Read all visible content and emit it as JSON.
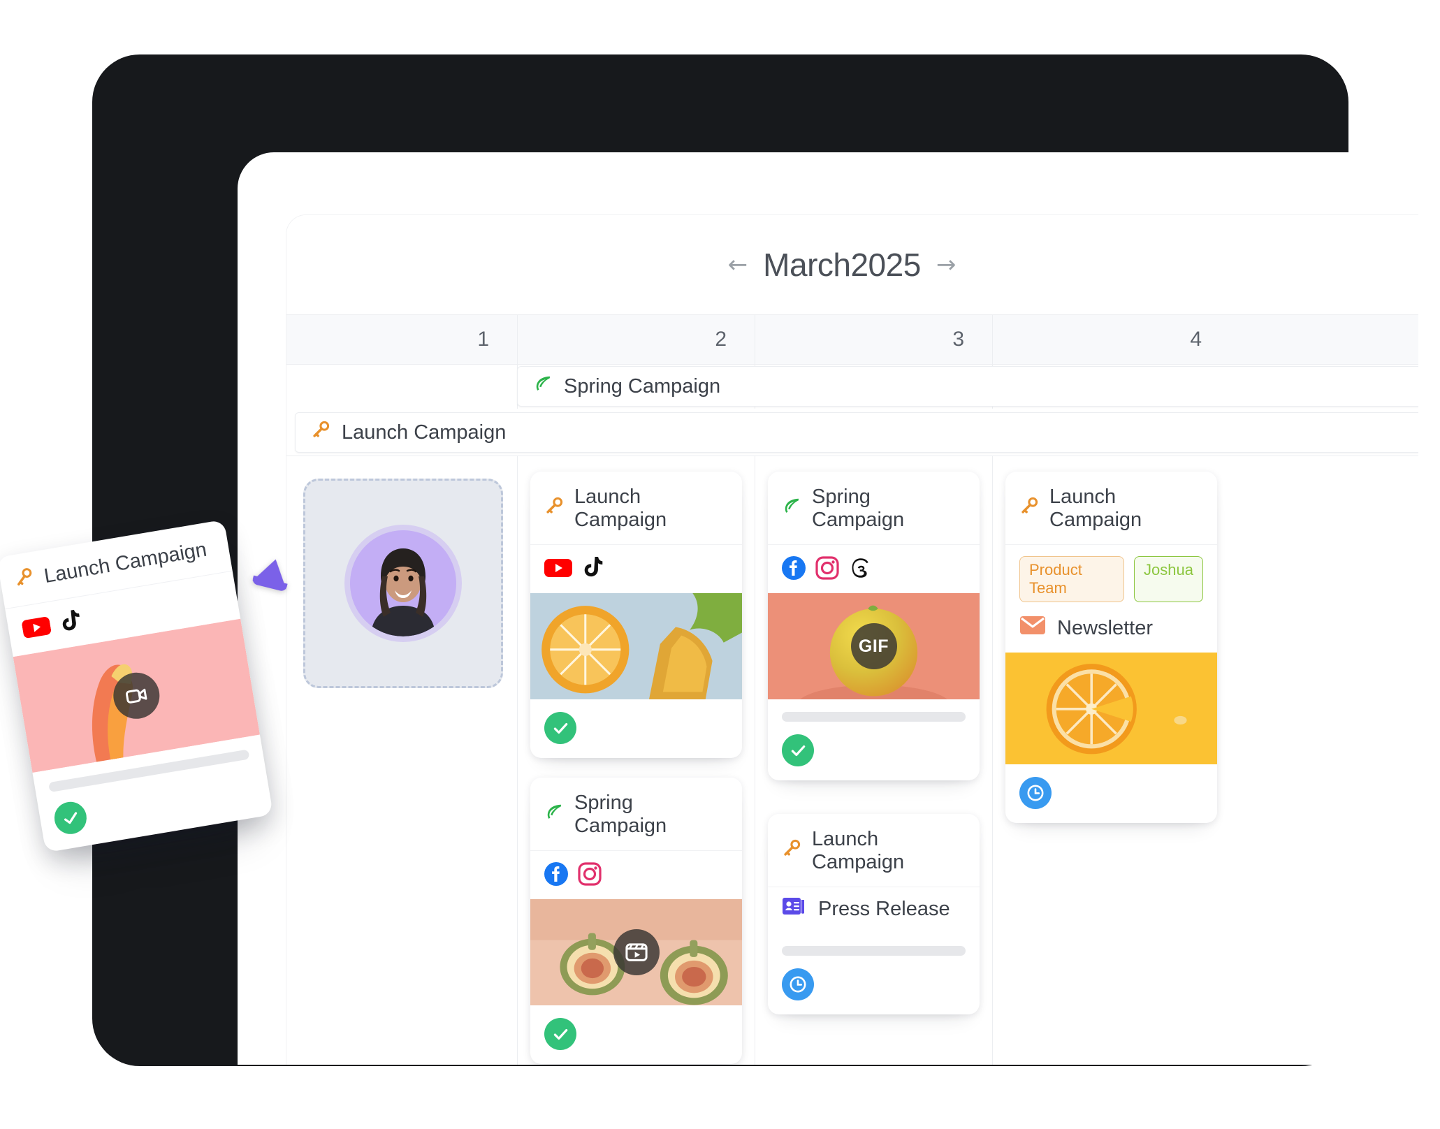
{
  "header": {
    "prev_label": "←",
    "next_label": "→",
    "month_label": "March2025",
    "prev_name": "previous-month",
    "next_name": "next-month"
  },
  "day_columns": [
    {
      "label": "1"
    },
    {
      "label": "2"
    },
    {
      "label": "3"
    },
    {
      "label": "4"
    }
  ],
  "span_bars": [
    {
      "label": "Spring Campaign",
      "icon": "leaf-icon",
      "color": "#2cb34a"
    },
    {
      "label": "Launch Campaign",
      "icon": "key-icon",
      "color": "#e8912c"
    }
  ],
  "drop_zone": {
    "name": "drop-zone",
    "avatar_name": "avatar"
  },
  "drag_card": {
    "title": "Launch Campaign",
    "campaign_icon": "key-icon",
    "channels": [
      "youtube-icon",
      "tiktok-icon"
    ],
    "media_badge": "video-camera-icon",
    "media_style": "m-pink",
    "status": "done"
  },
  "columns": [
    {
      "index": 1,
      "cards": []
    },
    {
      "index": 2,
      "cards": [
        {
          "title": "Launch Campaign",
          "campaign_icon": "key-icon",
          "channels": [
            "youtube-icon",
            "tiktok-icon"
          ],
          "media_style": "m-citrus",
          "media_badge": "",
          "skeleton": false,
          "status": "done",
          "stacked": false
        },
        {
          "title": "Spring Campaign",
          "campaign_icon": "leaf-icon",
          "channels": [
            "facebook-icon",
            "instagram-icon"
          ],
          "media_style": "m-figs",
          "media_badge": "reels-icon",
          "skeleton": false,
          "status": "done",
          "stacked": true
        }
      ]
    },
    {
      "index": 3,
      "cards": [
        {
          "title": "Spring Campaign",
          "campaign_icon": "leaf-icon",
          "channels": [
            "facebook-icon",
            "instagram-icon",
            "threads-icon"
          ],
          "media_style": "m-grapefruit",
          "media_badge": "GIF",
          "skeleton": true,
          "status": "done",
          "stacked": false
        },
        {
          "title": "Launch Campaign",
          "campaign_icon": "key-icon",
          "subtitle": "Press Release",
          "subtitle_icon": "press-release-icon",
          "skeleton": true,
          "status": "scheduled",
          "stacked": false
        }
      ]
    },
    {
      "index": 4,
      "cards": [
        {
          "title": "Launch Campaign",
          "campaign_icon": "key-icon",
          "tags": [
            {
              "label": "Product Team",
              "style": "tag-orange"
            },
            {
              "label": "Joshua",
              "style": "tag-green"
            }
          ],
          "subtitle": "Newsletter",
          "subtitle_icon": "newsletter-icon",
          "media_style": "m-orange-yellow",
          "media_badge": "",
          "skeleton": false,
          "status": "scheduled",
          "stacked": false
        }
      ]
    }
  ],
  "colors": {
    "accent_purple": "#7b61e8",
    "status_done": "#32c27a",
    "status_scheduled": "#389af0",
    "campaign_launch": "#e8912c",
    "campaign_spring": "#2cb34a",
    "bezel": "#17191c",
    "grid_line": "#eceef1",
    "text_primary": "#3c4149",
    "text_muted": "#5d636c"
  }
}
